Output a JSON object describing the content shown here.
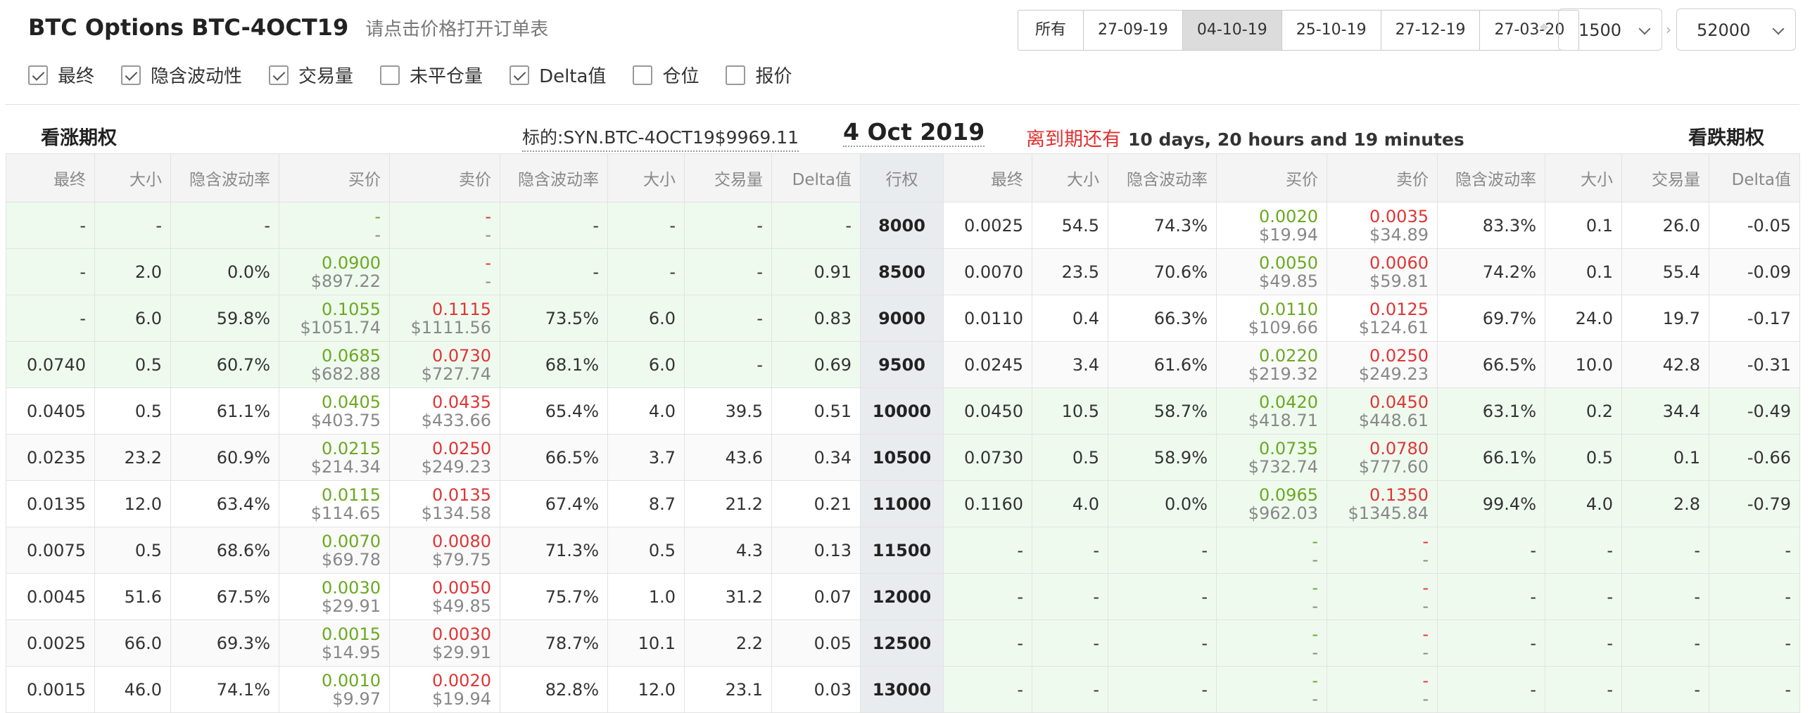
{
  "header": {
    "title": "BTC Options BTC-4OCT19",
    "subtitle": "请点击价格打开订单表"
  },
  "expiry_tabs": [
    "所有",
    "27-09-19",
    "04-10-19",
    "25-10-19",
    "27-12-19",
    "27-03-20"
  ],
  "active_expiry": "04-10-19",
  "selects": {
    "range_low": "1500",
    "range_high": "52000"
  },
  "toggles": [
    {
      "label": "最终",
      "checked": true
    },
    {
      "label": "隐含波动性",
      "checked": true
    },
    {
      "label": "交易量",
      "checked": true
    },
    {
      "label": "未平仓量",
      "checked": false
    },
    {
      "label": "Delta值",
      "checked": true
    },
    {
      "label": "仓位",
      "checked": false
    },
    {
      "label": "报价",
      "checked": false
    }
  ],
  "info": {
    "calls_label": "看涨期权",
    "puts_label": "看跌期权",
    "underlying": "标的:SYN.BTC-4OCT19$9969.11",
    "date": "4 Oct 2019",
    "expiry_label": "离到期还有",
    "expiry_value": "10 days, 20 hours and 19 minutes"
  },
  "columns": {
    "calls": [
      "最终",
      "大小",
      "隐含波动率",
      "买价",
      "卖价",
      "隐含波动率",
      "大小",
      "交易量",
      "Delta值"
    ],
    "strike": "行权",
    "puts": [
      "最终",
      "大小",
      "隐含波动率",
      "买价",
      "卖价",
      "隐含波动率",
      "大小",
      "交易量",
      "Delta值"
    ]
  },
  "rows": [
    {
      "strike": "8000",
      "call_itm": true,
      "put_itm": false,
      "call": {
        "last": "-",
        "bid_size": "-",
        "bid_iv": "-",
        "bid": "-",
        "bid_usd": "-",
        "ask": "-",
        "ask_usd": "-",
        "ask_iv": "-",
        "ask_size": "-",
        "volume": "-",
        "delta": "-"
      },
      "put": {
        "last": "0.0025",
        "bid_size": "54.5",
        "bid_iv": "74.3%",
        "bid": "0.0020",
        "bid_usd": "$19.94",
        "ask": "0.0035",
        "ask_usd": "$34.89",
        "ask_iv": "83.3%",
        "ask_size": "0.1",
        "volume": "26.0",
        "delta": "-0.05"
      }
    },
    {
      "strike": "8500",
      "call_itm": true,
      "put_itm": false,
      "call": {
        "last": "-",
        "bid_size": "2.0",
        "bid_iv": "0.0%",
        "bid": "0.0900",
        "bid_usd": "$897.22",
        "ask": "-",
        "ask_usd": "-",
        "ask_iv": "-",
        "ask_size": "-",
        "volume": "-",
        "delta": "0.91"
      },
      "put": {
        "last": "0.0070",
        "bid_size": "23.5",
        "bid_iv": "70.6%",
        "bid": "0.0050",
        "bid_usd": "$49.85",
        "ask": "0.0060",
        "ask_usd": "$59.81",
        "ask_iv": "74.2%",
        "ask_size": "0.1",
        "volume": "55.4",
        "delta": "-0.09"
      }
    },
    {
      "strike": "9000",
      "call_itm": true,
      "put_itm": false,
      "call": {
        "last": "-",
        "bid_size": "6.0",
        "bid_iv": "59.8%",
        "bid": "0.1055",
        "bid_usd": "$1051.74",
        "ask": "0.1115",
        "ask_usd": "$1111.56",
        "ask_iv": "73.5%",
        "ask_size": "6.0",
        "volume": "-",
        "delta": "0.83"
      },
      "put": {
        "last": "0.0110",
        "bid_size": "0.4",
        "bid_iv": "66.3%",
        "bid": "0.0110",
        "bid_usd": "$109.66",
        "ask": "0.0125",
        "ask_usd": "$124.61",
        "ask_iv": "69.7%",
        "ask_size": "24.0",
        "volume": "19.7",
        "delta": "-0.17"
      }
    },
    {
      "strike": "9500",
      "call_itm": true,
      "put_itm": false,
      "call": {
        "last": "0.0740",
        "bid_size": "0.5",
        "bid_iv": "60.7%",
        "bid": "0.0685",
        "bid_usd": "$682.88",
        "ask": "0.0730",
        "ask_usd": "$727.74",
        "ask_iv": "68.1%",
        "ask_size": "6.0",
        "volume": "-",
        "delta": "0.69"
      },
      "put": {
        "last": "0.0245",
        "bid_size": "3.4",
        "bid_iv": "61.6%",
        "bid": "0.0220",
        "bid_usd": "$219.32",
        "ask": "0.0250",
        "ask_usd": "$249.23",
        "ask_iv": "66.5%",
        "ask_size": "10.0",
        "volume": "42.8",
        "delta": "-0.31"
      }
    },
    {
      "strike": "10000",
      "call_itm": false,
      "put_itm": true,
      "call": {
        "last": "0.0405",
        "bid_size": "0.5",
        "bid_iv": "61.1%",
        "bid": "0.0405",
        "bid_usd": "$403.75",
        "ask": "0.0435",
        "ask_usd": "$433.66",
        "ask_iv": "65.4%",
        "ask_size": "4.0",
        "volume": "39.5",
        "delta": "0.51"
      },
      "put": {
        "last": "0.0450",
        "bid_size": "10.5",
        "bid_iv": "58.7%",
        "bid": "0.0420",
        "bid_usd": "$418.71",
        "ask": "0.0450",
        "ask_usd": "$448.61",
        "ask_iv": "63.1%",
        "ask_size": "0.2",
        "volume": "34.4",
        "delta": "-0.49"
      }
    },
    {
      "strike": "10500",
      "call_itm": false,
      "put_itm": true,
      "call": {
        "last": "0.0235",
        "bid_size": "23.2",
        "bid_iv": "60.9%",
        "bid": "0.0215",
        "bid_usd": "$214.34",
        "ask": "0.0250",
        "ask_usd": "$249.23",
        "ask_iv": "66.5%",
        "ask_size": "3.7",
        "volume": "43.6",
        "delta": "0.34"
      },
      "put": {
        "last": "0.0730",
        "bid_size": "0.5",
        "bid_iv": "58.9%",
        "bid": "0.0735",
        "bid_usd": "$732.74",
        "ask": "0.0780",
        "ask_usd": "$777.60",
        "ask_iv": "66.1%",
        "ask_size": "0.5",
        "volume": "0.1",
        "delta": "-0.66"
      }
    },
    {
      "strike": "11000",
      "call_itm": false,
      "put_itm": true,
      "call": {
        "last": "0.0135",
        "bid_size": "12.0",
        "bid_iv": "63.4%",
        "bid": "0.0115",
        "bid_usd": "$114.65",
        "ask": "0.0135",
        "ask_usd": "$134.58",
        "ask_iv": "67.4%",
        "ask_size": "8.7",
        "volume": "21.2",
        "delta": "0.21"
      },
      "put": {
        "last": "0.1160",
        "bid_size": "4.0",
        "bid_iv": "0.0%",
        "bid": "0.0965",
        "bid_usd": "$962.03",
        "ask": "0.1350",
        "ask_usd": "$1345.84",
        "ask_iv": "99.4%",
        "ask_size": "4.0",
        "volume": "2.8",
        "delta": "-0.79"
      }
    },
    {
      "strike": "11500",
      "call_itm": false,
      "put_itm": true,
      "call": {
        "last": "0.0075",
        "bid_size": "0.5",
        "bid_iv": "68.6%",
        "bid": "0.0070",
        "bid_usd": "$69.78",
        "ask": "0.0080",
        "ask_usd": "$79.75",
        "ask_iv": "71.3%",
        "ask_size": "0.5",
        "volume": "4.3",
        "delta": "0.13"
      },
      "put": {
        "last": "-",
        "bid_size": "-",
        "bid_iv": "-",
        "bid": "-",
        "bid_usd": "-",
        "ask": "-",
        "ask_usd": "-",
        "ask_iv": "-",
        "ask_size": "-",
        "volume": "-",
        "delta": "-"
      }
    },
    {
      "strike": "12000",
      "call_itm": false,
      "put_itm": true,
      "call": {
        "last": "0.0045",
        "bid_size": "51.6",
        "bid_iv": "67.5%",
        "bid": "0.0030",
        "bid_usd": "$29.91",
        "ask": "0.0050",
        "ask_usd": "$49.85",
        "ask_iv": "75.7%",
        "ask_size": "1.0",
        "volume": "31.2",
        "delta": "0.07"
      },
      "put": {
        "last": "-",
        "bid_size": "-",
        "bid_iv": "-",
        "bid": "-",
        "bid_usd": "-",
        "ask": "-",
        "ask_usd": "-",
        "ask_iv": "-",
        "ask_size": "-",
        "volume": "-",
        "delta": "-"
      }
    },
    {
      "strike": "12500",
      "call_itm": false,
      "put_itm": true,
      "call": {
        "last": "0.0025",
        "bid_size": "66.0",
        "bid_iv": "69.3%",
        "bid": "0.0015",
        "bid_usd": "$14.95",
        "ask": "0.0030",
        "ask_usd": "$29.91",
        "ask_iv": "78.7%",
        "ask_size": "10.1",
        "volume": "2.2",
        "delta": "0.05"
      },
      "put": {
        "last": "-",
        "bid_size": "-",
        "bid_iv": "-",
        "bid": "-",
        "bid_usd": "-",
        "ask": "-",
        "ask_usd": "-",
        "ask_iv": "-",
        "ask_size": "-",
        "volume": "-",
        "delta": "-"
      }
    },
    {
      "strike": "13000",
      "call_itm": false,
      "put_itm": true,
      "call": {
        "last": "0.0015",
        "bid_size": "46.0",
        "bid_iv": "74.1%",
        "bid": "0.0010",
        "bid_usd": "$9.97",
        "ask": "0.0020",
        "ask_usd": "$19.94",
        "ask_iv": "82.8%",
        "ask_size": "12.0",
        "volume": "23.1",
        "delta": "0.03"
      },
      "put": {
        "last": "-",
        "bid_size": "-",
        "bid_iv": "-",
        "bid": "-",
        "bid_usd": "-",
        "ask": "-",
        "ask_usd": "-",
        "ask_iv": "-",
        "ask_size": "-",
        "volume": "-",
        "delta": "-"
      }
    }
  ]
}
